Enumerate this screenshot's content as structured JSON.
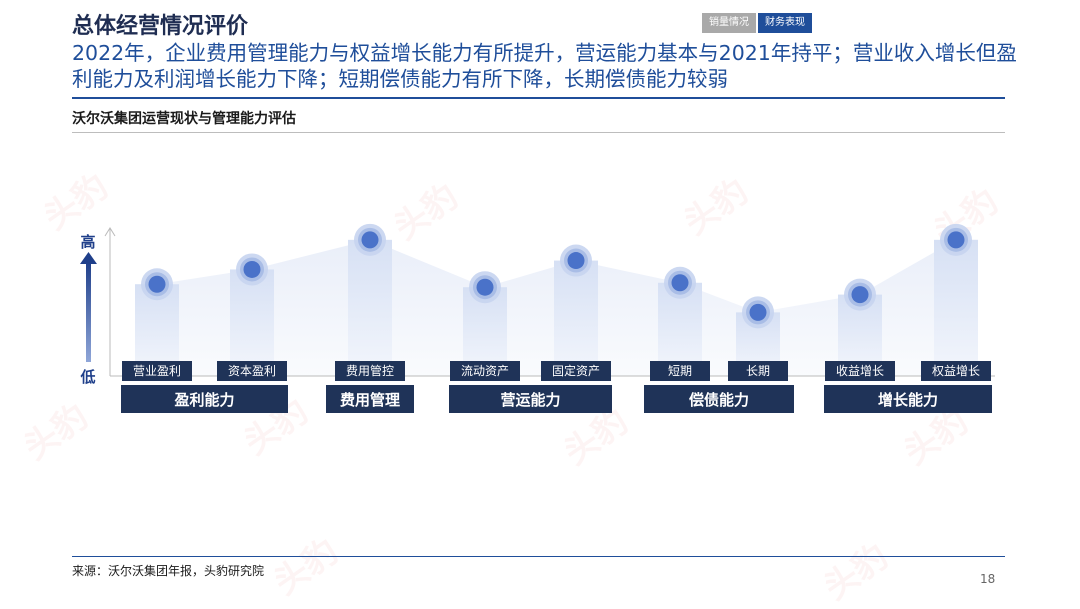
{
  "header": {
    "title": "总体经营情况评价",
    "tabs": [
      {
        "label": "销量情况",
        "active": false
      },
      {
        "label": "财务表现",
        "active": true
      }
    ]
  },
  "headline": "2022年，企业费用管理能力与权益增长能力有所提升，营运能力基本与2021年持平；营业收入增长但盈利能力及利润增长能力下降；短期偿债能力有所下降，长期偿债能力较弱",
  "subtitle": "沃尔沃集团运营现状与管理能力评估",
  "watermark": {
    "text": "头豹"
  },
  "chart_data": {
    "type": "bar",
    "y_axis": {
      "high_label": "高",
      "low_label": "低"
    },
    "categories": [
      "营业盈利",
      "资本盈利",
      "费用管控",
      "流动资产",
      "固定资产",
      "短期",
      "长期",
      "收益增长",
      "权益增长"
    ],
    "values": [
      0.62,
      0.72,
      0.92,
      0.6,
      0.78,
      0.63,
      0.43,
      0.55,
      0.92
    ],
    "groups": [
      {
        "label": "盈利能力",
        "from": 0,
        "to": 1
      },
      {
        "label": "费用管理",
        "from": 2,
        "to": 2
      },
      {
        "label": "营运能力",
        "from": 3,
        "to": 4
      },
      {
        "label": "偿债能力",
        "from": 5,
        "to": 6
      },
      {
        "label": "增长能力",
        "from": 7,
        "to": 8
      }
    ],
    "colors": {
      "bar": "#dfe6f5",
      "dot": "#4a72c9",
      "group_box": "#1f3358",
      "label_box": "#1f3358"
    }
  },
  "footer": {
    "source": "来源：沃尔沃集团年报，头豹研究院",
    "page_number": "18"
  }
}
